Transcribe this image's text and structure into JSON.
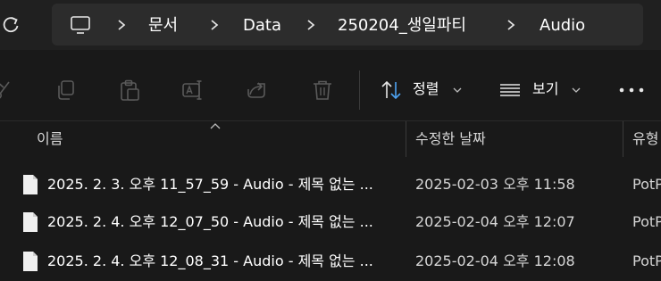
{
  "breadcrumb": {
    "items": [
      "문서",
      "Data",
      "250204_생일파티",
      "Audio"
    ]
  },
  "toolbar": {
    "sort_label": "정렬",
    "view_label": "보기"
  },
  "columns": {
    "name": "이름",
    "modified": "수정한 날짜",
    "type": "유형"
  },
  "files": [
    {
      "name": "2025. 2. 3. 오후 11_57_59 - Audio - 제목 없는 ...",
      "modified": "2025-02-03 오후 11:58",
      "type": "PotP"
    },
    {
      "name": "2025. 2. 4. 오후 12_07_50 - Audio - 제목 없는 ...",
      "modified": "2025-02-04 오후 12:07",
      "type": "PotP"
    },
    {
      "name": "2025. 2. 4. 오후 12_08_31 - Audio - 제목 없는 ...",
      "modified": "2025-02-04 오후 12:08",
      "type": "PotP"
    }
  ],
  "colors": {
    "window_bg": "#191919",
    "address_bg": "#2c2c2c",
    "accent": "#4ea3f1",
    "disabled_icon": "#5a5a5a"
  }
}
